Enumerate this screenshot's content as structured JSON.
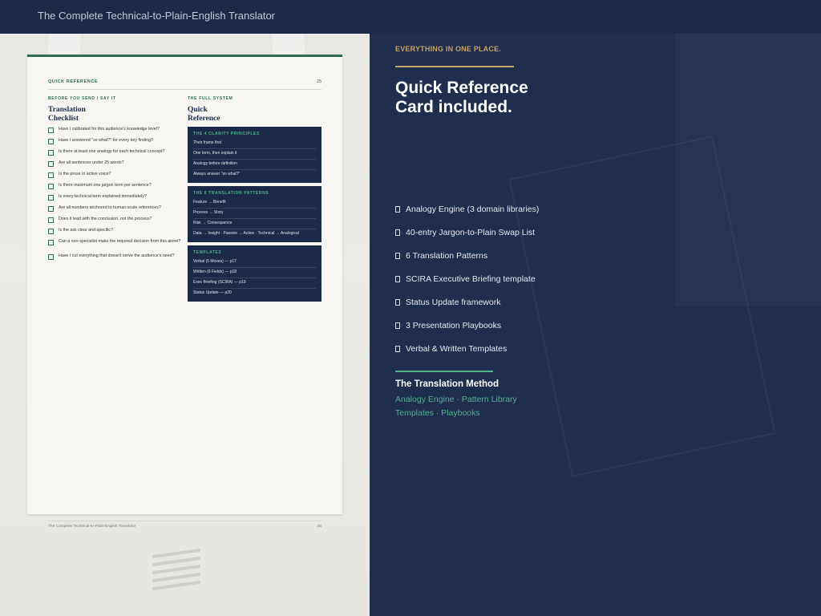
{
  "header": {
    "title": "The Complete Technical-to-Plain-English Translator"
  },
  "colors": {
    "navy": "#1c2a4a",
    "green": "#2e6b4f",
    "accent_green": "#4fb28a",
    "gold": "#c5a36a"
  },
  "document_page": {
    "header_label": "QUICK REFERENCE",
    "page_number": "25",
    "checklist": {
      "kicker": "BEFORE YOU SEND / SAY IT",
      "title_line1": "Translation",
      "title_line2": "Checklist",
      "items": [
        "Have I calibrated for this audience's knowledge level?",
        "Have I answered \"so what?\" for every key finding?",
        "Is there at least one analogy for each technical concept?",
        "Are all sentences under 25 words?",
        "Is the prose in active voice?",
        "Is there maximum one jargon term per sentence?",
        "Is every technical term explained immediately?",
        "Are all numbers anchored to human-scale references?",
        "Does it lead with the conclusion, not the process?",
        "Is the ask clear and specific?",
        "Can a non-specialist make the required decision from this alone?",
        "Have I cut everything that doesn't serve the audience's need?"
      ]
    },
    "reference": {
      "kicker": "THE FULL SYSTEM",
      "title_line1": "Quick",
      "title_line2": "Reference",
      "cards": [
        {
          "title": "THE 4 CLARITY PRINCIPLES",
          "items": [
            "Their frame first",
            "One term, then explain it",
            "Analogy before definition",
            "Always answer \"so what?\""
          ]
        },
        {
          "title": "THE 6 TRANSLATION PATTERNS",
          "items": [
            "Feature → Benefit",
            "Process → Story",
            "Risk → Consequence",
            "Data → Insight · Passive → Active · Technical → Analogical"
          ]
        },
        {
          "title": "TEMPLATES",
          "items": [
            "Verbal (5 Moves) — p17",
            "Written (6 Fields) — p18",
            "Exec Briefing (SCIRA) — p19",
            "Status Update — p20"
          ]
        }
      ]
    },
    "footer_text": "The Complete Technical-to-Plain-English Translator",
    "footer_page": "25"
  },
  "promo": {
    "kicker": "EVERYTHING IN ONE PLACE.",
    "headline_line1": "Quick Reference",
    "headline_line2": "Card included.",
    "features": [
      "Analogy Engine (3 domain libraries)",
      "40-entry Jargon-to-Plain Swap List",
      "6 Translation Patterns",
      "SCIRA Executive Briefing template",
      "Status Update framework",
      "3 Presentation Playbooks",
      "Verbal & Written Templates"
    ],
    "method_title": "The Translation Method",
    "method_line1": "Analogy Engine · Pattern Library",
    "method_line2": "Templates · Playbooks"
  }
}
